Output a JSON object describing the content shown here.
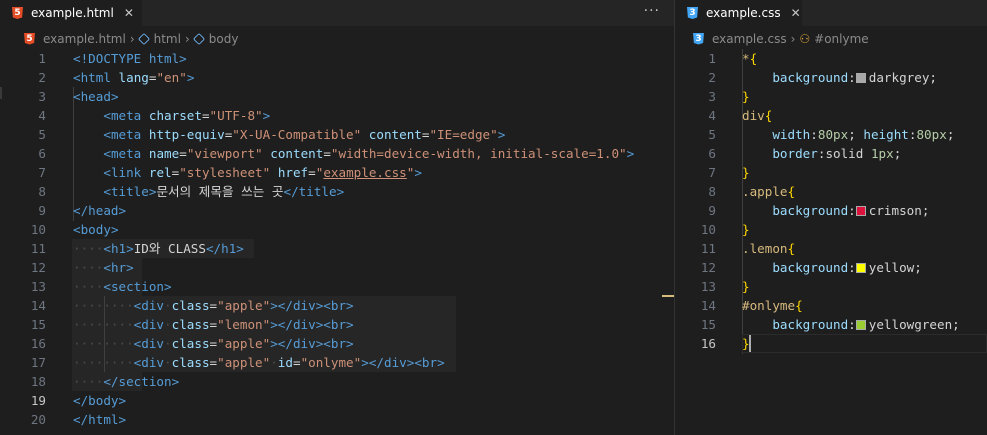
{
  "left_editor": {
    "tab": {
      "icon": "html5-icon",
      "icon_glyph": "5",
      "title": "example.html",
      "close": "✕"
    },
    "more_actions": "···",
    "breadcrumb": [
      "example.html",
      "html",
      "body"
    ],
    "active_line": 19,
    "lines": [
      [
        [
          "<!DOCTYPE ",
          "t"
        ],
        [
          "html",
          "t"
        ],
        [
          ">",
          "t"
        ]
      ],
      [
        [
          "<",
          "t"
        ],
        [
          "html",
          "t"
        ],
        [
          " ",
          "p"
        ],
        [
          "lang",
          "a"
        ],
        [
          "=",
          "p"
        ],
        [
          "\"en\"",
          "s"
        ],
        [
          ">",
          "t"
        ]
      ],
      [
        [
          "<",
          "t"
        ],
        [
          "head",
          "t"
        ],
        [
          ">",
          "t"
        ]
      ],
      [
        [
          "    ",
          "p"
        ],
        [
          "<",
          "t"
        ],
        [
          "meta",
          "t"
        ],
        [
          " ",
          "p"
        ],
        [
          "charset",
          "a"
        ],
        [
          "=",
          "p"
        ],
        [
          "\"UTF-8\"",
          "s"
        ],
        [
          ">",
          "t"
        ]
      ],
      [
        [
          "    ",
          "p"
        ],
        [
          "<",
          "t"
        ],
        [
          "meta",
          "t"
        ],
        [
          " ",
          "p"
        ],
        [
          "http-equiv",
          "a"
        ],
        [
          "=",
          "p"
        ],
        [
          "\"X-UA-Compatible\"",
          "s"
        ],
        [
          " ",
          "p"
        ],
        [
          "content",
          "a"
        ],
        [
          "=",
          "p"
        ],
        [
          "\"IE=edge\"",
          "s"
        ],
        [
          ">",
          "t"
        ]
      ],
      [
        [
          "    ",
          "p"
        ],
        [
          "<",
          "t"
        ],
        [
          "meta",
          "t"
        ],
        [
          " ",
          "p"
        ],
        [
          "name",
          "a"
        ],
        [
          "=",
          "p"
        ],
        [
          "\"viewport\"",
          "s"
        ],
        [
          " ",
          "p"
        ],
        [
          "content",
          "a"
        ],
        [
          "=",
          "p"
        ],
        [
          "\"width=device-width, initial-scale=1.0\"",
          "s"
        ],
        [
          ">",
          "t"
        ]
      ],
      [
        [
          "    ",
          "p"
        ],
        [
          "<",
          "t"
        ],
        [
          "link",
          "t"
        ],
        [
          " ",
          "p"
        ],
        [
          "rel",
          "a"
        ],
        [
          "=",
          "p"
        ],
        [
          "\"stylesheet\"",
          "s"
        ],
        [
          " ",
          "p"
        ],
        [
          "href",
          "a"
        ],
        [
          "=",
          "p"
        ],
        [
          "\"",
          "s"
        ],
        [
          "example.css",
          "s ul"
        ],
        [
          "\"",
          "s"
        ],
        [
          ">",
          "t"
        ]
      ],
      [
        [
          "    ",
          "p"
        ],
        [
          "<",
          "t"
        ],
        [
          "title",
          "t"
        ],
        [
          ">",
          "t"
        ],
        [
          "문서의 제목을 쓰는 곳",
          "p"
        ],
        [
          "</",
          "t"
        ],
        [
          "title",
          "t"
        ],
        [
          ">",
          "t"
        ]
      ],
      [
        [
          "</",
          "t"
        ],
        [
          "head",
          "t"
        ],
        [
          ">",
          "t"
        ]
      ],
      [
        [
          "<",
          "t"
        ],
        [
          "body",
          "t"
        ],
        [
          ">",
          "t"
        ]
      ],
      [
        [
          "····",
          "ws"
        ],
        [
          "<",
          "t"
        ],
        [
          "h1",
          "t"
        ],
        [
          ">",
          "t"
        ],
        [
          "ID와 CLASS",
          "p"
        ],
        [
          "</",
          "t"
        ],
        [
          "h1",
          "t"
        ],
        [
          ">",
          "t"
        ]
      ],
      [
        [
          "····",
          "ws"
        ],
        [
          "<",
          "t"
        ],
        [
          "hr",
          "t"
        ],
        [
          ">",
          "t"
        ]
      ],
      [
        [
          "····",
          "ws"
        ],
        [
          "<",
          "t"
        ],
        [
          "section",
          "t"
        ],
        [
          ">",
          "t"
        ]
      ],
      [
        [
          "········",
          "ws"
        ],
        [
          "<",
          "t"
        ],
        [
          "div",
          "t"
        ],
        [
          "·",
          "ws"
        ],
        [
          "class",
          "a"
        ],
        [
          "=",
          "p"
        ],
        [
          "\"apple\"",
          "s"
        ],
        [
          "></",
          "t"
        ],
        [
          "div",
          "t"
        ],
        [
          "><",
          "t"
        ],
        [
          "br",
          "t"
        ],
        [
          ">",
          "t"
        ]
      ],
      [
        [
          "········",
          "ws"
        ],
        [
          "<",
          "t"
        ],
        [
          "div",
          "t"
        ],
        [
          "·",
          "ws"
        ],
        [
          "class",
          "a"
        ],
        [
          "=",
          "p"
        ],
        [
          "\"lemon\"",
          "s"
        ],
        [
          "></",
          "t"
        ],
        [
          "div",
          "t"
        ],
        [
          "><",
          "t"
        ],
        [
          "br",
          "t"
        ],
        [
          ">",
          "t"
        ]
      ],
      [
        [
          "········",
          "ws"
        ],
        [
          "<",
          "t"
        ],
        [
          "div",
          "t"
        ],
        [
          "·",
          "ws"
        ],
        [
          "class",
          "a"
        ],
        [
          "=",
          "p"
        ],
        [
          "\"apple\"",
          "s"
        ],
        [
          "></",
          "t"
        ],
        [
          "div",
          "t"
        ],
        [
          "><",
          "t"
        ],
        [
          "br",
          "t"
        ],
        [
          ">",
          "t"
        ]
      ],
      [
        [
          "········",
          "ws"
        ],
        [
          "<",
          "t"
        ],
        [
          "div",
          "t"
        ],
        [
          "·",
          "ws"
        ],
        [
          "class",
          "a"
        ],
        [
          "=",
          "p"
        ],
        [
          "\"apple\"",
          "s"
        ],
        [
          "·",
          "ws"
        ],
        [
          "id",
          "a"
        ],
        [
          "=",
          "p"
        ],
        [
          "\"onlyme\"",
          "s"
        ],
        [
          "></",
          "t"
        ],
        [
          "div",
          "t"
        ],
        [
          "><",
          "t"
        ],
        [
          "br",
          "t"
        ],
        [
          ">",
          "t"
        ]
      ],
      [
        [
          "····",
          "ws"
        ],
        [
          "</",
          "t"
        ],
        [
          "section",
          "t"
        ],
        [
          ">",
          "t"
        ]
      ],
      [
        [
          "</",
          "t"
        ],
        [
          "body",
          "t"
        ],
        [
          ">",
          "t"
        ]
      ],
      [
        [
          "</",
          "t"
        ],
        [
          "html",
          "t"
        ],
        [
          ">",
          "t"
        ]
      ]
    ]
  },
  "right_editor": {
    "tab": {
      "icon": "css3-icon",
      "icon_glyph": "3",
      "title": "example.css",
      "close": "✕"
    },
    "breadcrumb": [
      "example.css",
      "#onlyme"
    ],
    "active_line": 16,
    "lines": [
      [
        [
          "*",
          "sel"
        ],
        [
          "{",
          "br"
        ]
      ],
      [
        [
          "    ",
          "p"
        ],
        [
          "background",
          "a"
        ],
        [
          ":",
          "p"
        ],
        [
          "§#a9a9a9",
          "sw"
        ],
        [
          "darkgrey;",
          "p"
        ]
      ],
      [
        [
          "}",
          "br"
        ]
      ],
      [
        [
          "div",
          "sel"
        ],
        [
          "{",
          "br"
        ]
      ],
      [
        [
          "    ",
          "p"
        ],
        [
          "width",
          "a"
        ],
        [
          ":",
          "p"
        ],
        [
          "80px",
          "n"
        ],
        [
          "; ",
          "p"
        ],
        [
          "height",
          "a"
        ],
        [
          ":",
          "p"
        ],
        [
          "80px",
          "n"
        ],
        [
          ";",
          "p"
        ]
      ],
      [
        [
          "    ",
          "p"
        ],
        [
          "border",
          "a"
        ],
        [
          ":",
          "p"
        ],
        [
          "solid ",
          "p"
        ],
        [
          "1px",
          "n"
        ],
        [
          ";",
          "p"
        ]
      ],
      [
        [
          "}",
          "br"
        ]
      ],
      [
        [
          ".apple",
          "sel"
        ],
        [
          "{",
          "br"
        ]
      ],
      [
        [
          "    ",
          "p"
        ],
        [
          "background",
          "a"
        ],
        [
          ":",
          "p"
        ],
        [
          "§#dc143c",
          "sw"
        ],
        [
          "crimson;",
          "p"
        ]
      ],
      [
        [
          "}",
          "br"
        ]
      ],
      [
        [
          ".lemon",
          "sel"
        ],
        [
          "{",
          "br"
        ]
      ],
      [
        [
          "    ",
          "p"
        ],
        [
          "background",
          "a"
        ],
        [
          ":",
          "p"
        ],
        [
          "§#ffff00",
          "sw"
        ],
        [
          "yellow;",
          "p"
        ]
      ],
      [
        [
          "}",
          "br"
        ]
      ],
      [
        [
          "#onlyme",
          "sel"
        ],
        [
          "{",
          "br"
        ]
      ],
      [
        [
          "    ",
          "p"
        ],
        [
          "background",
          "a"
        ],
        [
          ":",
          "p"
        ],
        [
          "§#9acd32",
          "sw"
        ],
        [
          "yellowgreen;",
          "p"
        ]
      ],
      [
        [
          "}",
          "br"
        ]
      ]
    ]
  }
}
